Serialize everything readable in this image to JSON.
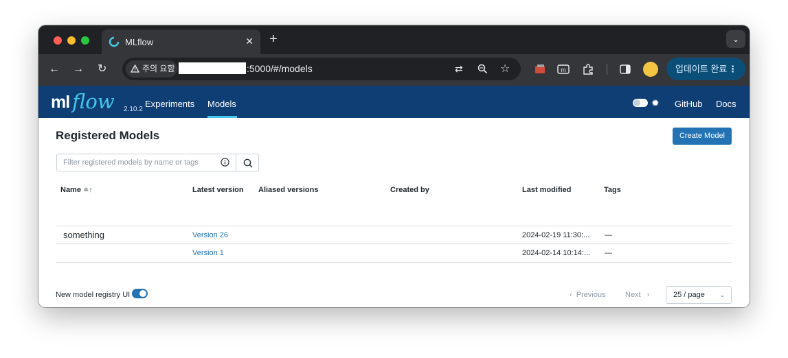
{
  "browser": {
    "tab_title": "MLflow",
    "tab_close": "✕",
    "new_tab": "+",
    "security_label": "주의 요함",
    "url_suffix": ":5000/#/models",
    "update_button": "업데이트 완료",
    "update_menu": "⋮"
  },
  "app": {
    "logo_ml": "ml",
    "logo_flow": "flow",
    "version": "2.10.2",
    "nav": [
      "Experiments",
      "Models"
    ],
    "active_nav": "Models",
    "links": [
      "GitHub",
      "Docs"
    ],
    "accent_color": "#43c9ed",
    "header_color": "#0f3e74"
  },
  "page": {
    "title": "Registered Models",
    "create_button": "Create Model",
    "filter_placeholder": "Filter registered models by name or tags",
    "columns": [
      "Name",
      "Latest version",
      "Aliased versions",
      "Created by",
      "Last modified",
      "Tags"
    ],
    "rows": [
      {
        "name": "something",
        "latest_version": "Version 26",
        "aliased": "",
        "created_by": "",
        "last_modified": "2024-02-19 11:30:...",
        "tags": "—"
      },
      {
        "name": "",
        "latest_version": "Version 1",
        "aliased": "",
        "created_by": "",
        "last_modified": "2024-02-14 10:14:...",
        "tags": "—"
      }
    ],
    "new_registry_label": "New model registry UI",
    "prev_label": "Previous",
    "next_label": "Next",
    "page_size": "25 / page"
  },
  "icons": [
    "back-arrow-icon",
    "forward-arrow-icon",
    "reload-icon",
    "warning-icon",
    "translate-icon",
    "zoom-icon",
    "star-icon",
    "extension-icon",
    "sidepanel-icon",
    "info-icon",
    "search-icon",
    "sort-icon",
    "sun-icon",
    "chevron-down-icon"
  ]
}
